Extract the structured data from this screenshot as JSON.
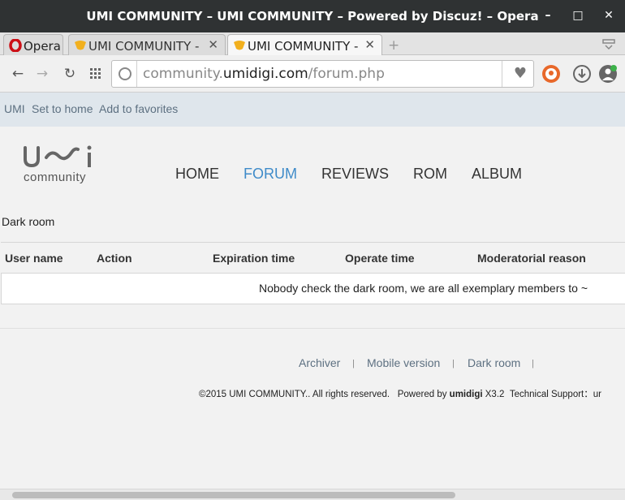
{
  "window": {
    "title": "UMI COMMUNITY – UMI COMMUNITY – Powered by Discuz! – Opera",
    "minimize": "–",
    "maximize": "□",
    "close": "✕"
  },
  "tabs": [
    {
      "label": "Opera",
      "icon": "opera-logo-icon"
    },
    {
      "label": "UMI COMMUNITY - F",
      "icon": "favicon-icon"
    },
    {
      "label": "UMI COMMUNITY - U",
      "icon": "favicon-icon"
    }
  ],
  "tab_close": "✕",
  "new_tab": "+",
  "toolbar": {
    "back": "←",
    "forward": "→",
    "reload": "↻",
    "url_prefix": "community.",
    "url_host": "umidigi.com",
    "url_path": "/forum.php",
    "bookmark_icon": "♥"
  },
  "topbar": {
    "links": [
      "UMI",
      "Set to home",
      "Add to favorites"
    ]
  },
  "logo": {
    "text": "community"
  },
  "nav": {
    "items": [
      "HOME",
      "FORUM",
      "REVIEWS",
      "ROM",
      "ALBUM"
    ],
    "active": "FORUM",
    "active_color": "#3f8bc9"
  },
  "breadcrumb": "Dark room",
  "table": {
    "headers": [
      "User name",
      "Action",
      "Expiration time",
      "Operate time",
      "Moderatorial reason"
    ],
    "empty_message": "Nobody check the dark room, we are all exemplary members to ~"
  },
  "footer": {
    "links": [
      "Archiver",
      "Mobile version",
      "Dark room"
    ],
    "separator": "|",
    "copyright": "©2015  UMI COMMUNITY.. All rights reserved.",
    "powered_prefix": "Powered by",
    "powered_brand": "umidigi",
    "powered_version": "X3.2",
    "support": "Technical Support：ur"
  }
}
